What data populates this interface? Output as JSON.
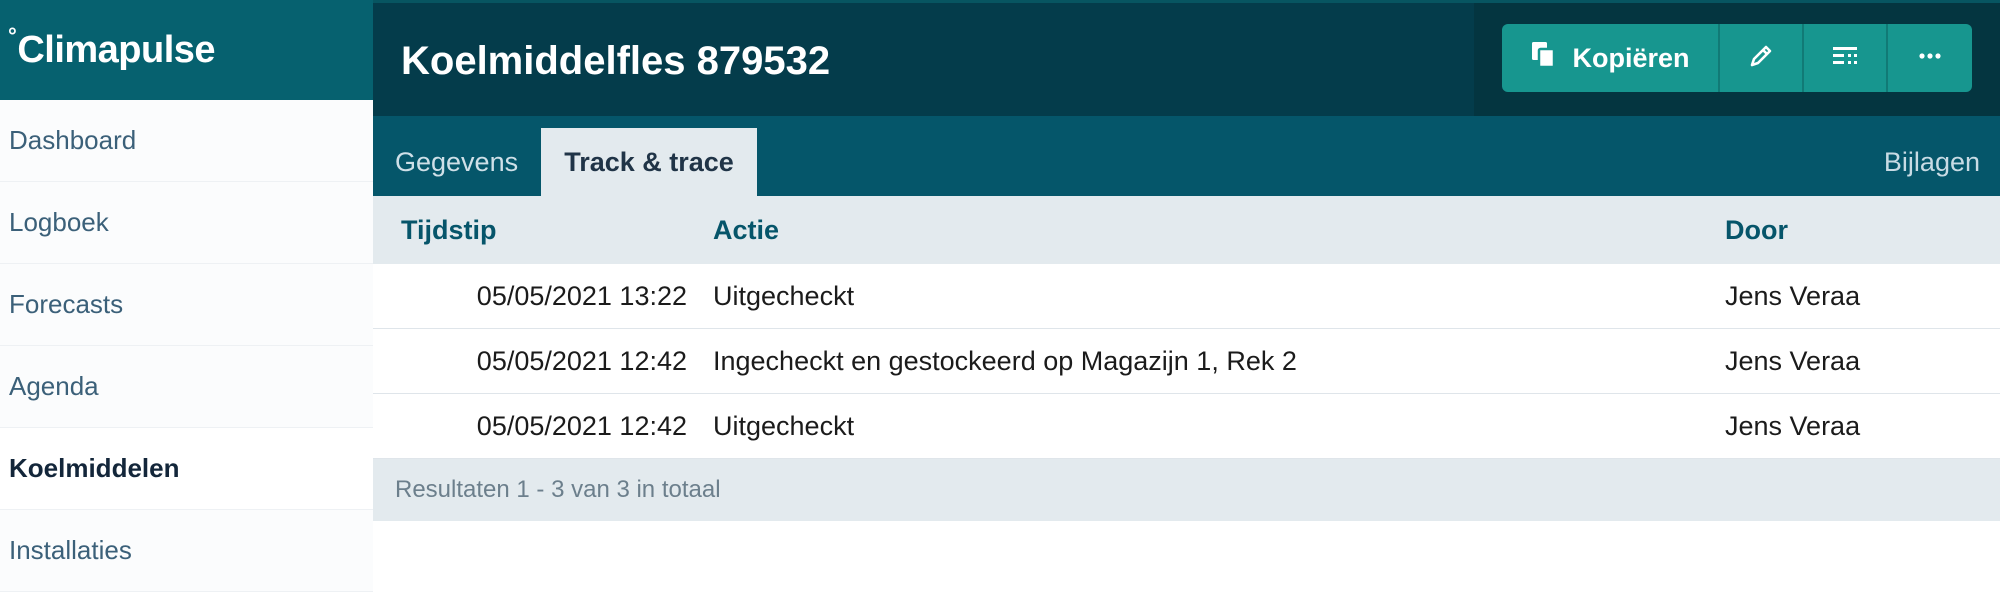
{
  "brand": {
    "degree": "°",
    "name": "Climapulse"
  },
  "sidebar": {
    "items": [
      {
        "label": "Dashboard"
      },
      {
        "label": "Logboek"
      },
      {
        "label": "Forecasts"
      },
      {
        "label": "Agenda"
      },
      {
        "label": "Koelmiddelen",
        "active": true
      },
      {
        "label": "Installaties"
      }
    ]
  },
  "header": {
    "title": "Koelmiddelfles 879532",
    "toolbar": {
      "copy_label": "Kopiëren",
      "buttons": [
        {
          "icon": "copy-icon"
        },
        {
          "icon": "pencil-icon"
        },
        {
          "icon": "list-icon"
        },
        {
          "icon": "more-icon"
        }
      ]
    }
  },
  "tabs": {
    "items": [
      {
        "label": "Gegevens"
      },
      {
        "label": "Track & trace",
        "active": true
      }
    ],
    "right": "Bijlagen"
  },
  "table": {
    "columns": [
      "Tijdstip",
      "Actie",
      "Door"
    ],
    "rows": [
      {
        "time": "05/05/2021 13:22",
        "action": "Uitgecheckt",
        "by": "Jens Veraa"
      },
      {
        "time": "05/05/2021 12:42",
        "action": "Ingecheckt en gestockeerd op Magazijn 1, Rek 2",
        "by": "Jens Veraa"
      },
      {
        "time": "05/05/2021 12:42",
        "action": "Uitgecheckt",
        "by": "Jens Veraa"
      }
    ],
    "footer": "Resultaten 1 - 3 van 3 in totaal"
  },
  "colors": {
    "brand_bg": "#06616f",
    "header_bg": "#043c4b",
    "tab_bar_bg": "#05566a",
    "button_bg": "#17968f",
    "accent_text": "#06556a"
  }
}
